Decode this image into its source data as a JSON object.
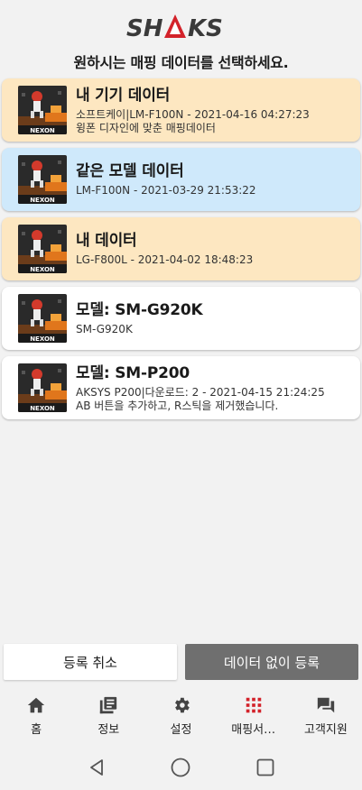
{
  "header": {
    "logo_text": "SHAKS",
    "subtitle": "원하시는 매핑 데이터를 선택하세요."
  },
  "colors": {
    "mine": "#fde7c1",
    "same_model": "#cfe9fb",
    "other": "#ffffff",
    "accent_red": "#d3222a"
  },
  "mappings": [
    {
      "kind": "mine",
      "title": "내 기기 데이터",
      "line1": "소프트케이|LM-F100N - 2021-04-16 04:27:23",
      "line2": "윙폰 디자인에 맞춘 매핑데이터",
      "thumb_label": "NEXON"
    },
    {
      "kind": "same_model",
      "title": "같은 모델 데이터",
      "line1": "LM-F100N - 2021-03-29 21:53:22",
      "line2": "",
      "thumb_label": "NEXON"
    },
    {
      "kind": "mine",
      "title": "내 데이터",
      "line1": "LG-F800L - 2021-04-02 18:48:23",
      "line2": "",
      "thumb_label": "NEXON"
    },
    {
      "kind": "other",
      "title": "모델: SM-G920K",
      "line1": "SM-G920K",
      "line2": "",
      "thumb_label": "NEXON"
    },
    {
      "kind": "other",
      "title": "모델: SM-P200",
      "line1": "AKSYS P200|다운로드: 2 - 2021-04-15 21:24:25",
      "line2": "AB 버튼을 추가하고, R스틱을 제거했습니다.",
      "thumb_label": "NEXON"
    }
  ],
  "actions": {
    "cancel_label": "등록 취소",
    "register_label": "데이터 없이 등록"
  },
  "bottom_nav": [
    {
      "label": "홈",
      "icon": "home-icon"
    },
    {
      "label": "정보",
      "icon": "library-icon"
    },
    {
      "label": "설정",
      "icon": "gear-icon"
    },
    {
      "label": "매핑서…",
      "icon": "grid-icon",
      "active": true
    },
    {
      "label": "고객지원",
      "icon": "chat-icon"
    }
  ],
  "system_nav": [
    "back-icon",
    "home-circle-icon",
    "recents-icon"
  ]
}
